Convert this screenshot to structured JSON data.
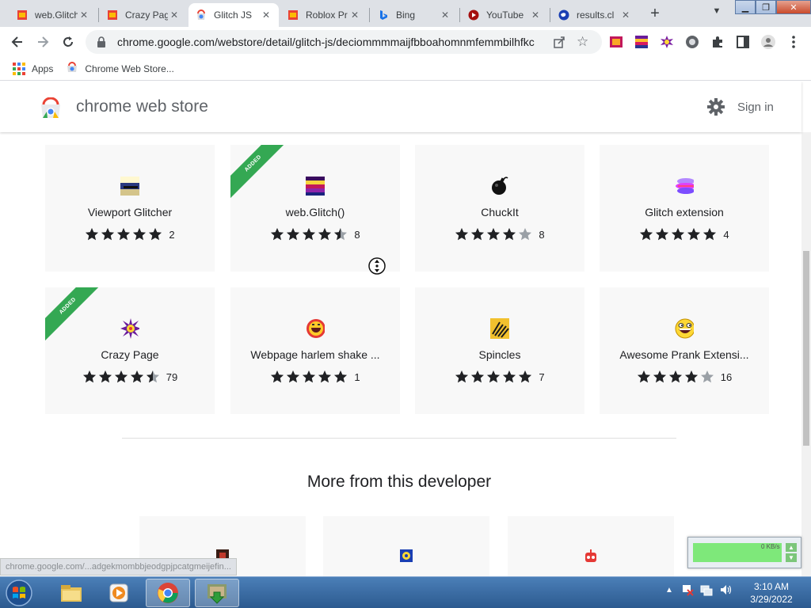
{
  "browser": {
    "tabs": [
      {
        "title": "web.Glitch()",
        "favicon": "glitch-favicon"
      },
      {
        "title": "Crazy Page",
        "favicon": "crazy-page-favicon"
      },
      {
        "title": "Glitch JS",
        "favicon": "webstore-favicon",
        "active": true
      },
      {
        "title": "Roblox Pr",
        "favicon": "roblox-favicon"
      },
      {
        "title": "Bing",
        "favicon": "bing-favicon"
      },
      {
        "title": "YouTube",
        "favicon": "youtube-favicon"
      },
      {
        "title": "results.cl",
        "favicon": "globe-favicon"
      }
    ],
    "url": "chrome.google.com/webstore/detail/glitch-js/deciommmmaijfbboahomnmfemmbilhfkc",
    "bookmarks": [
      "Apps",
      "Chrome Web Store..."
    ],
    "status_url": "chrome.google.com/...adgekmombbjeodgpjpcatgmeijefin..."
  },
  "store": {
    "title": "chrome web store",
    "sign_in": "Sign in"
  },
  "related": [
    {
      "name": "Viewport Glitcher",
      "rating": 5,
      "count": "2",
      "added": false,
      "icon": "viewport-glitcher-icon"
    },
    {
      "name": "web.Glitch()",
      "rating": 4.5,
      "count": "8",
      "added": true,
      "icon": "web-glitch-icon"
    },
    {
      "name": "ChuckIt",
      "rating": 4,
      "count": "8",
      "added": false,
      "icon": "bomb-icon"
    },
    {
      "name": "Glitch extension",
      "rating": 5,
      "count": "4",
      "added": false,
      "icon": "glitch-extension-icon"
    },
    {
      "name": "Crazy Page",
      "rating": 4.5,
      "count": "79",
      "added": true,
      "icon": "crazy-page-icon"
    },
    {
      "name": "Webpage harlem shake ...",
      "rating": 5,
      "count": "1",
      "added": false,
      "icon": "harlem-shake-icon"
    },
    {
      "name": "Spincles",
      "rating": 5,
      "count": "7",
      "added": false,
      "icon": "spincles-icon"
    },
    {
      "name": "Awesome Prank Extensi...",
      "rating": 4,
      "count": "16",
      "added": false,
      "icon": "awesome-face-icon"
    }
  ],
  "added_label": "ADDED",
  "more_title": "More from this developer",
  "widget_text": "0 KB/s",
  "clock": {
    "time": "3:10 AM",
    "date": "3/29/2022"
  },
  "colors": {
    "accent_green": "#34a853",
    "star": "#202124",
    "taskbar": "#2c5a8f"
  }
}
